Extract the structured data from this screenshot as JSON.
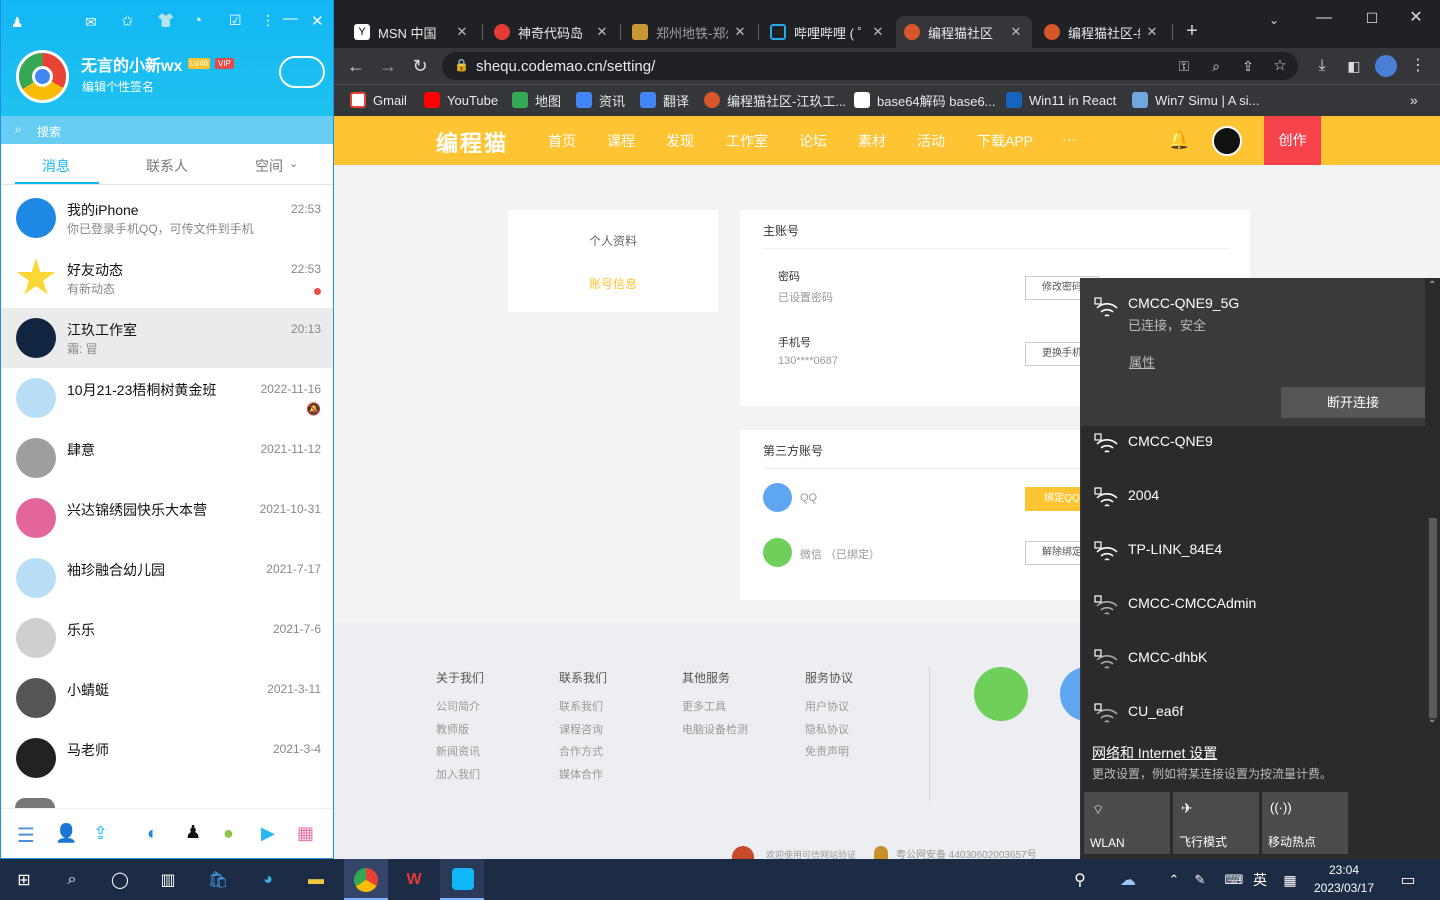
{
  "qq": {
    "nickname": "无言的小新wx",
    "level_badge": "LV46",
    "vip_badge": "VIP",
    "signature": "编辑个性签名",
    "search_placeholder": "搜索",
    "tabs": [
      "消息",
      "联系人",
      "空间"
    ],
    "conversations": [
      {
        "name": "我的iPhone",
        "preview": "你已登录手机QQ，可传文件到手机",
        "time": "22:53"
      },
      {
        "name": "好友动态",
        "preview": "有新动态",
        "time": "22:53"
      },
      {
        "name": "江玖工作室",
        "preview": "霜: 冒",
        "time": "20:13"
      },
      {
        "name": "10月21-23梧桐树黄金班",
        "preview": "",
        "time": "2022-11-16"
      },
      {
        "name": "肆意",
        "preview": "",
        "time": "2021-11-12"
      },
      {
        "name": "兴达锦绣园快乐大本营",
        "preview": "",
        "time": "2021-10-31"
      },
      {
        "name": "袖珍融合幼儿园",
        "preview": "",
        "time": "2021-7-17"
      },
      {
        "name": "乐乐",
        "preview": "",
        "time": "2021-7-6"
      },
      {
        "name": "小蜻蜓",
        "preview": "",
        "time": "2021-3-11"
      },
      {
        "name": "马老师",
        "preview": "",
        "time": "2021-3-4"
      }
    ]
  },
  "browser": {
    "tabs": [
      {
        "title": "MSN 中国"
      },
      {
        "title": "神奇代码岛"
      },
      {
        "title": "郑州地铁-郑州"
      },
      {
        "title": "哔哩哔哩 ( ゜- ゜"
      },
      {
        "title": "编程猫社区"
      },
      {
        "title": "编程猫社区-编"
      }
    ],
    "url": "shequ.codemao.cn/setting/",
    "bookmarks": [
      "Gmail",
      "YouTube",
      "地图",
      "资讯",
      "翻译",
      "编程猫社区-江玖工...",
      "base64解码 base6...",
      "Win11 in React",
      "Win7 Simu | A si..."
    ]
  },
  "site": {
    "logo": "编程猫",
    "nav": [
      "首页",
      "课程",
      "发现",
      "工作室",
      "论坛",
      "素材",
      "活动",
      "下载APP",
      "···"
    ],
    "create_button": "创作",
    "sidebar": {
      "profile": "个人资料",
      "account": "账号信息"
    },
    "main_account": {
      "title": "主账号",
      "password_label": "密码",
      "password_value": "已设置密码",
      "password_button": "修改密码",
      "phone_label": "手机号",
      "phone_value": "130****0687",
      "phone_button": "更换手机"
    },
    "third_party": {
      "title": "第三方账号",
      "qq_label": "QQ",
      "qq_button": "绑定QQ",
      "wechat_label": "微信 （已绑定）",
      "wechat_button": "解除绑定"
    },
    "footer": {
      "columns": [
        {
          "title": "关于我们",
          "links": [
            "公司简介",
            "教师版",
            "新闻资讯",
            "加入我们"
          ]
        },
        {
          "title": "联系我们",
          "links": [
            "联系我们",
            "课程咨询",
            "合作方式",
            "媒体合作"
          ]
        },
        {
          "title": "其他服务",
          "links": [
            "更多工具",
            "电脑设备检测"
          ]
        },
        {
          "title": "服务协议",
          "links": [
            "用户协议",
            "隐私协议",
            "免责声明"
          ]
        }
      ],
      "bottom_left": "欢迎使用可信网站验证",
      "bottom_right": "粤公网安备 44030602003657号"
    }
  },
  "wifi": {
    "connected": {
      "name": "CMCC-QNE9_5G",
      "status": "已连接，安全",
      "properties": "属性",
      "disconnect": "断开连接"
    },
    "networks": [
      "CMCC-QNE9",
      "2004",
      "TP-LINK_84E4",
      "CMCC-CMCCAdmin",
      "CMCC-dhbK",
      "CU_ea6f"
    ],
    "settings_link": "网络和 Internet 设置",
    "settings_desc": "更改设置，例如将某连接设置为按流量计费。",
    "quick_actions": [
      "WLAN",
      "飞行模式",
      "移动热点"
    ]
  },
  "taskbar": {
    "time": "23:04",
    "date": "2023/03/17",
    "ime": "英"
  }
}
